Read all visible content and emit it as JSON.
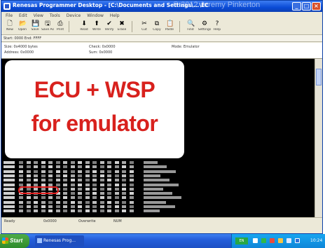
{
  "window": {
    "title": "Renesas Programmer Desktop - [C:\\Documents and Settings\\...\\ECU+WSP.ecu]",
    "watermark": "© 2012 Jeremy Pinkerton",
    "minimize": "_",
    "maximize": "□",
    "close": "×"
  },
  "menu": [
    "File",
    "Edit",
    "View",
    "Tools",
    "Device",
    "Window",
    "Help"
  ],
  "toolbar": {
    "buttons": [
      {
        "icon": "new-icon",
        "glyph": "🗋",
        "label": "New"
      },
      {
        "icon": "open-icon",
        "glyph": "📂",
        "label": "Open"
      },
      {
        "icon": "save-icon",
        "glyph": "💾",
        "label": "Save"
      },
      {
        "icon": "saveas-icon",
        "glyph": "🖫",
        "label": "Save As"
      },
      {
        "icon": "print-icon",
        "glyph": "⎙",
        "label": "Print"
      },
      {
        "icon": "read-icon",
        "glyph": "⬇",
        "label": "Read"
      },
      {
        "icon": "write-icon",
        "glyph": "⬆",
        "label": "Write"
      },
      {
        "icon": "verify-icon",
        "glyph": "✔",
        "label": "Verify"
      },
      {
        "icon": "erase-icon",
        "glyph": "✖",
        "label": "Erase"
      },
      {
        "icon": "cut-icon",
        "glyph": "✂",
        "label": "Cut"
      },
      {
        "icon": "copy-icon",
        "glyph": "⧉",
        "label": "Copy"
      },
      {
        "icon": "paste-icon",
        "glyph": "📋",
        "label": "Paste"
      },
      {
        "icon": "find-icon",
        "glyph": "🔍",
        "label": "Find"
      },
      {
        "icon": "settings-icon",
        "glyph": "⚙",
        "label": "Settings"
      },
      {
        "icon": "help-icon",
        "glyph": "?",
        "label": "Help"
      }
    ]
  },
  "fields_bar": "Start: 0000  End: FFFF",
  "info": {
    "col1a": "Size: 0x4000 bytes",
    "col1b": "Address: 0x0000",
    "col2a": "Check: 0x0000",
    "col2b": "Sum: 0x0000",
    "col3a": "Mode: Emulator"
  },
  "overlay": {
    "line1": "ECU + WSP",
    "line2": "for emulator"
  },
  "status": {
    "cell1": "Ready",
    "cell2": "0x0000",
    "cell3": "Overwrite",
    "cell4": "NUM"
  },
  "taskbar": {
    "start": "Start",
    "task1": "Renesas Prog...",
    "lang": "EN",
    "clock": "10:24"
  }
}
